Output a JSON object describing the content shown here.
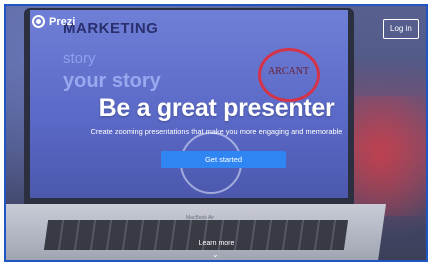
{
  "background": {
    "laptop_brand": "MacBook Air",
    "screen_words": {
      "line1": "MARKETING",
      "line2": "story",
      "line3": "your story",
      "logo": "ARCANT"
    }
  },
  "header": {
    "logo_text": "Prezi",
    "login_label": "Log in"
  },
  "hero": {
    "headline": "Be a great presenter",
    "subheadline": "Create zooming presentations that make you more engaging and memorable",
    "cta_label": "Get started",
    "learn_more_label": "Learn more"
  },
  "colors": {
    "frame_border": "#1f56c4",
    "cta_blue": "#2f86f3",
    "text_white": "#ffffff"
  },
  "icons": {
    "logo": "prezi-logo-icon",
    "learn_more": "chevron-down-icon"
  }
}
